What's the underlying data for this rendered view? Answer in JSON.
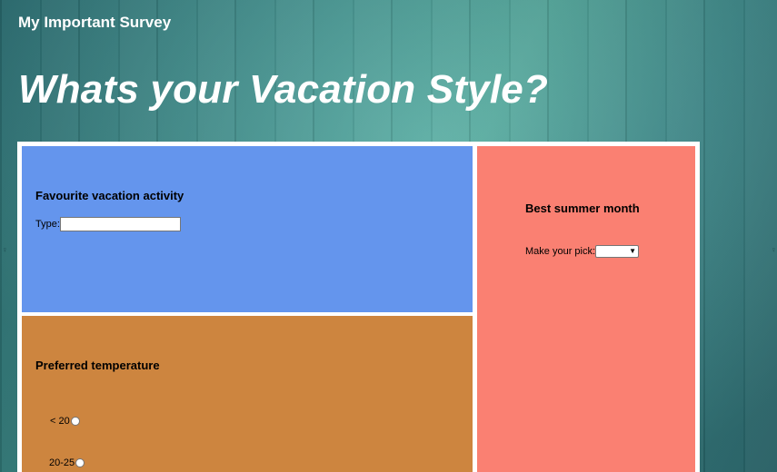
{
  "header": {
    "site_title": "My Important Survey",
    "heading": "Whats your Vacation Style?"
  },
  "activity": {
    "title": "Favourite vacation activity",
    "input_label": "Type:",
    "input_value": ""
  },
  "month": {
    "title": "Best summer month",
    "select_label": "Make your pick:",
    "selected_value": ""
  },
  "temperature": {
    "title": "Preferred temperature",
    "options": [
      {
        "label": "< 20",
        "checked": false
      },
      {
        "label": "20-25",
        "checked": false
      }
    ]
  },
  "colors": {
    "activity_panel": "#6495ed",
    "month_panel": "#fa8072",
    "temperature_panel": "#cd853f",
    "frame": "#ffffff"
  }
}
